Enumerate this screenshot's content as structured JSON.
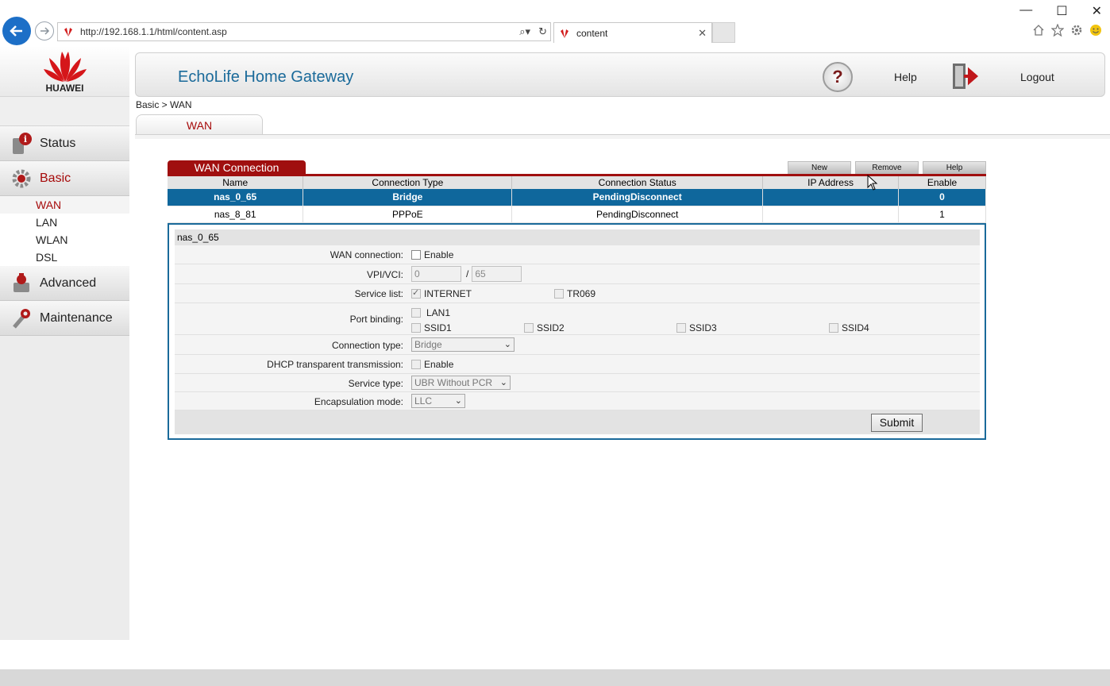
{
  "browser": {
    "url": "http://192.168.1.1/html/content.asp",
    "tab_title": "content"
  },
  "sidebar": {
    "logo": "HUAWEI",
    "items": [
      {
        "label": "Status"
      },
      {
        "label": "Basic"
      },
      {
        "label": "Advanced"
      },
      {
        "label": "Maintenance"
      }
    ],
    "basic_sub": [
      "WAN",
      "LAN",
      "WLAN",
      "DSL"
    ]
  },
  "header": {
    "title": "EchoLife Home Gateway",
    "help": "Help",
    "logout": "Logout"
  },
  "breadcrumb": "Basic > WAN",
  "page_tab": "WAN",
  "wan": {
    "title": "WAN Connection",
    "buttons": {
      "new": "New",
      "remove": "Remove",
      "help": "Help"
    },
    "columns": [
      "Name",
      "Connection Type",
      "Connection Status",
      "IP Address",
      "Enable"
    ],
    "rows": [
      {
        "name": "nas_0_65",
        "type": "Bridge",
        "status": "PendingDisconnect",
        "ip": "",
        "enable": "0"
      },
      {
        "name": "nas_8_81",
        "type": "PPPoE",
        "status": "PendingDisconnect",
        "ip": "",
        "enable": "1"
      }
    ]
  },
  "detail": {
    "heading": "nas_0_65",
    "wan_connection_label": "WAN connection:",
    "enable": "Enable",
    "vpi_vci_label": "VPI/VCI:",
    "vpi": "0",
    "vci": "65",
    "slash": "/",
    "service_list_label": "Service list:",
    "internet": "INTERNET",
    "tr069": "TR069",
    "port_binding_label": "Port binding:",
    "ports": [
      "LAN1",
      "SSID1",
      "SSID2",
      "SSID3",
      "SSID4"
    ],
    "conn_type_label": "Connection type:",
    "conn_type": "Bridge",
    "dhcp_label": "DHCP transparent transmission:",
    "service_type_label": "Service type:",
    "service_type": "UBR Without PCR",
    "encap_label": "Encapsulation mode:",
    "encap": "LLC",
    "submit": "Submit"
  },
  "colors": {
    "accent_red": "#a00f0f",
    "accent_blue": "#0f679c",
    "title_blue": "#1a6a9a"
  }
}
